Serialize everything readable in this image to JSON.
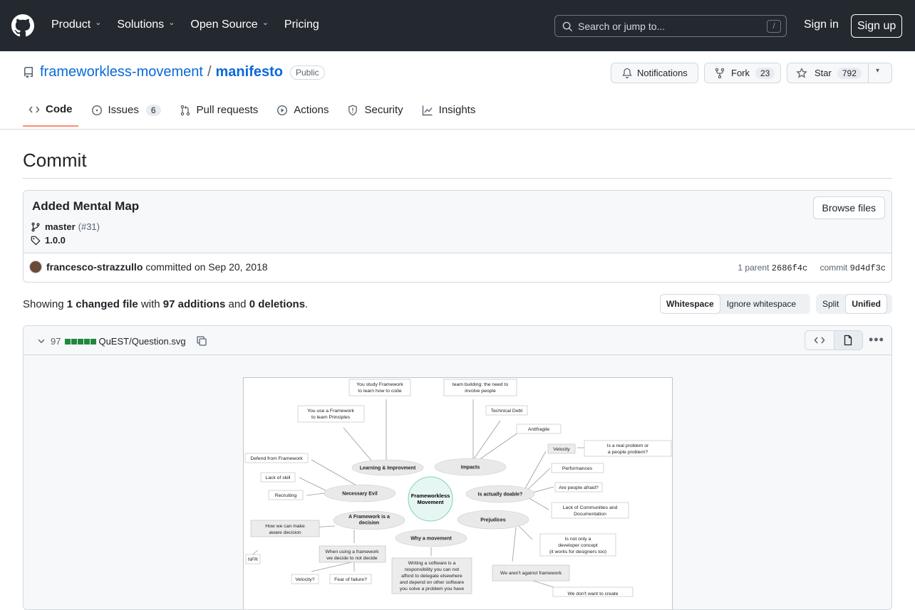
{
  "header": {
    "nav": [
      "Product",
      "Solutions",
      "Open Source",
      "Pricing"
    ],
    "search_placeholder": "Search or jump to...",
    "search_shortcut": "/",
    "sign_in": "Sign in",
    "sign_up": "Sign up"
  },
  "repo": {
    "owner": "frameworkless-movement",
    "name": "manifesto",
    "visibility": "Public",
    "notifications": "Notifications",
    "fork": "Fork",
    "fork_count": "23",
    "star": "Star",
    "star_count": "792"
  },
  "tabs": [
    {
      "label": "Code"
    },
    {
      "label": "Issues",
      "count": "6"
    },
    {
      "label": "Pull requests"
    },
    {
      "label": "Actions"
    },
    {
      "label": "Security"
    },
    {
      "label": "Insights"
    }
  ],
  "commit": {
    "page_title": "Commit",
    "message": "Added Mental Map",
    "browse": "Browse files",
    "branch": "master",
    "pr": "(#31)",
    "tag": "1.0.0",
    "author": "francesco-strazzullo",
    "committed": "committed on Sep 20, 2018",
    "parent_label": "1 parent",
    "parent": "2686f4c",
    "commit_label": "commit",
    "sha": "9d4df3c"
  },
  "summary": {
    "showing": "Showing",
    "files": "1 changed file",
    "with": "with",
    "additions": "97 additions",
    "and": "and",
    "deletions": "0 deletions",
    "end": "."
  },
  "diffopts": {
    "whitespace": "Whitespace",
    "ignore": "Ignore whitespace",
    "split": "Split",
    "unified": "Unified"
  },
  "file": {
    "changes": "97",
    "path": "QuEST/Question.svg"
  },
  "map": {
    "center": "Frameworkless Movement",
    "nodes": [
      "Learning & Improvment",
      "Impacts",
      "Necessary Evil",
      "Is actually doable?",
      "A Framework is a decision",
      "Prejudices",
      "Why a movement"
    ],
    "leaves": [
      "You study Framework to learn how to code",
      "team building: the need to involve people",
      "You use a Framework to learn Principles",
      "Technical Debt",
      "Antifragile",
      "Defend from Framework",
      "Velocity",
      "Is a real problem or a people problem?",
      "Lack of skill",
      "Performances",
      "Recruiting",
      "Are people afraid?",
      "Lack of Communities and Documentation",
      "How we can make aware decision",
      "Is not only a developer concept (it works for designers too)",
      "NFR",
      "When using a framework we decide to not decide",
      "Writing a software is a responsibility you can not afford to delegate elsewhere and depend on other software you solve a problem you have",
      "We aren't against framework",
      "Velocity?",
      "Fear of failure?",
      "We don't want to create"
    ]
  }
}
